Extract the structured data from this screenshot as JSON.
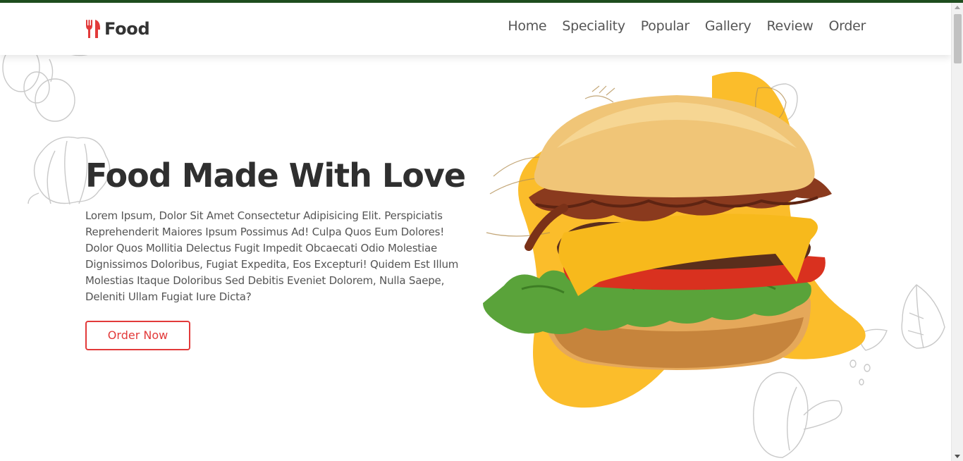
{
  "brand": {
    "logo_icon": "fork-knife-icon",
    "name": "Food",
    "icon_color": "#e23a3a"
  },
  "nav": {
    "items": [
      {
        "label": "Home"
      },
      {
        "label": "Speciality"
      },
      {
        "label": "Popular"
      },
      {
        "label": "Gallery"
      },
      {
        "label": "Review"
      },
      {
        "label": "Order"
      }
    ]
  },
  "hero": {
    "title": "Food Made With Love",
    "description": "Lorem Ipsum, Dolor Sit Amet Consectetur Adipisicing Elit. Perspiciatis Reprehenderit Maiores Ipsum Possimus Ad! Culpa Quos Eum Dolores! Dolor Quos Mollitia Delectus Fugit Impedit Obcaecati Odio Molestiae Dignissimos Doloribus, Fugiat Expedita, Eos Excepturi! Quidem Est Illum Molestias Itaque Doloribus Sed Debitis Eveniet Dolorem, Nulla Saepe, Deleniti Ullam Fugiat Iure Dicta?",
    "cta_label": "Order Now",
    "image": "burger-image",
    "accent_color": "#fbbd2b"
  },
  "theme": {
    "top_strip_color": "#1e4d1e",
    "cta_color": "#e23a3a"
  }
}
